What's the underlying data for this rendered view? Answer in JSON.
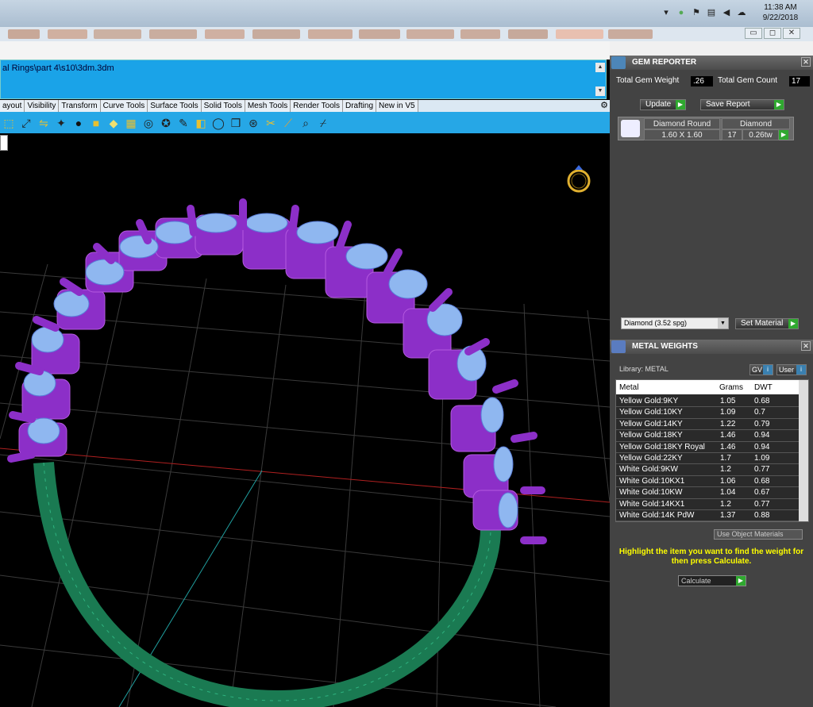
{
  "system": {
    "time": "11:38 AM",
    "date": "9/22/2018"
  },
  "window": {
    "minimize": "▭",
    "maximize": "◻",
    "close": "✕"
  },
  "file_path": "al Rings\\part 4\\s10\\3dm.3dm",
  "tabs": [
    "ayout",
    "Visibility",
    "Transform",
    "Curve Tools",
    "Surface Tools",
    "Solid Tools",
    "Mesh Tools",
    "Render Tools",
    "Drafting",
    "New in V5"
  ],
  "toolbar_icons": [
    "select-icon",
    "move-icon",
    "flip-icon",
    "gumball-icon",
    "sphere-icon",
    "box-icon",
    "surface-icon",
    "grid-icon",
    "spiral-icon",
    "wrench-icon",
    "pencil-icon",
    "globe-icon",
    "cube-icon",
    "target-icon",
    "clipboard-icon",
    "brush-icon",
    "magnify-icon",
    "dropper-icon"
  ],
  "gem_reporter": {
    "title": "GEM REPORTER",
    "total_weight_label": "Total Gem Weight",
    "total_weight": ".26",
    "total_count_label": "Total Gem Count",
    "total_count": "17",
    "update_label": "Update",
    "save_report_label": "Save Report",
    "gem": {
      "name": "Diamond Round",
      "material": "Diamond",
      "size": "1.60 X 1.60",
      "count": "17",
      "weight": "0.26tw"
    },
    "material_select": "Diamond    (3.52 spg)",
    "set_material_label": "Set Material"
  },
  "metal_weights": {
    "title": "METAL WEIGHTS",
    "library_label": "Library: METAL",
    "gv_label": "GV",
    "user_label": "User",
    "columns": [
      "Metal",
      "Grams",
      "DWT"
    ],
    "rows": [
      [
        "Yellow Gold:9KY",
        "1.05",
        "0.68"
      ],
      [
        "Yellow Gold:10KY",
        "1.09",
        "0.7"
      ],
      [
        "Yellow Gold:14KY",
        "1.22",
        "0.79"
      ],
      [
        "Yellow Gold:18KY",
        "1.46",
        "0.94"
      ],
      [
        "Yellow Gold:18KY Royal",
        "1.46",
        "0.94"
      ],
      [
        "Yellow Gold:22KY",
        "1.7",
        "1.09"
      ],
      [
        "White Gold:9KW",
        "1.2",
        "0.77"
      ],
      [
        "White Gold:10KX1",
        "1.06",
        "0.68"
      ],
      [
        "White Gold:10KW",
        "1.04",
        "0.67"
      ],
      [
        "White Gold:14KX1",
        "1.2",
        "0.77"
      ],
      [
        "White Gold:14K PdW",
        "1.37",
        "0.88"
      ]
    ],
    "use_object_materials_label": "Use Object Materials",
    "note": "Highlight the item you want to find the weight for then press Calculate.",
    "calculate_label": "Calculate"
  }
}
